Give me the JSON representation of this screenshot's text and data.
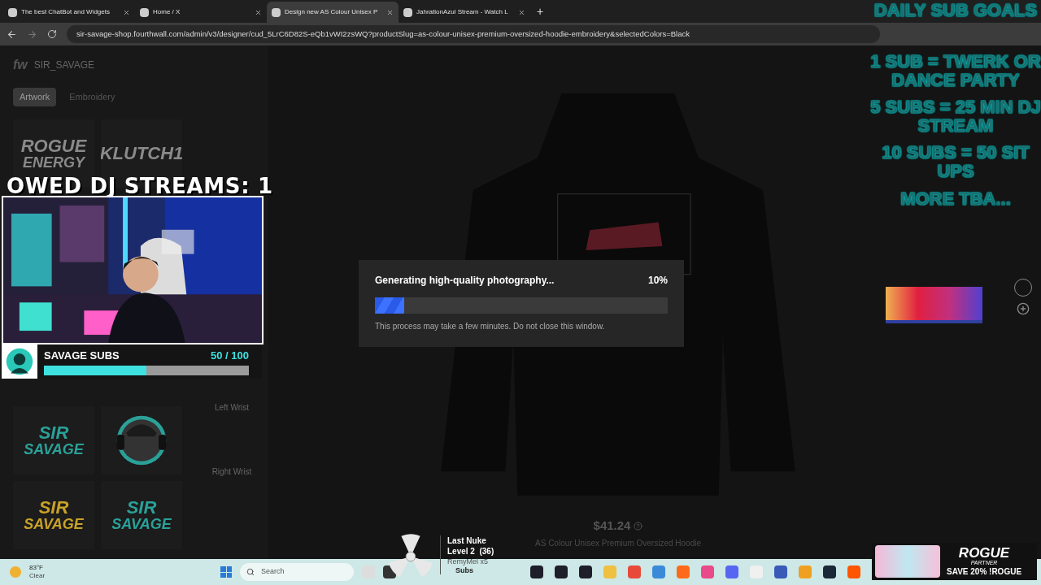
{
  "browser": {
    "tabs": [
      {
        "label": "The best ChatBot and Widgets",
        "selected": false
      },
      {
        "label": "Home / X",
        "selected": false
      },
      {
        "label": "Design new AS Colour Unisex P",
        "selected": true
      },
      {
        "label": "JahrationAzul Stream - Watch L",
        "selected": false
      }
    ],
    "new_tab": "+",
    "url": "sir-savage-shop.fourthwall.com/admin/v3/designer/cud_5LrC6D82S-eQb1vWI2zsWQ?productSlug=as-colour-unisex-premium-oversized-hoodie-embroidery&selectedColors=Black"
  },
  "designer": {
    "brand": "fw",
    "shop": "SIR_SAVAGE",
    "tabs": [
      {
        "label": "Artwork",
        "selected": true
      },
      {
        "label": "Embroidery",
        "selected": false
      }
    ],
    "artwork": [
      {
        "line1": "ROGUE",
        "line2": "ENERGY",
        "color": "#8a8a8a"
      },
      {
        "line1": "KLUTCH1",
        "color": "#8a8a8a"
      },
      {
        "line1": "SIR",
        "line2": "SAVAGE",
        "color": "#2aa198"
      },
      {
        "kind": "avatar",
        "color": "#2aa198"
      },
      {
        "line1": "SIR",
        "line2": "SAVAGE",
        "color": "#c9a227"
      },
      {
        "line1": "SIR",
        "line2": "SAVAGE",
        "color": "#2aa198"
      }
    ],
    "placements": [
      "Left Wrist",
      "Right Wrist"
    ],
    "price": "$41.24",
    "product": "AS Colour Unisex Premium Oversized Hoodie"
  },
  "progress_dialog": {
    "title": "Generating high-quality photography...",
    "percent": "10%",
    "level": 0.1,
    "note": "This process may take a few minutes. Do not close this window."
  },
  "stream_overlay": {
    "owed": "OWED DJ STREAMS: 1",
    "sub_goal": {
      "label": "SAVAGE SUBS",
      "count": "50 / 100",
      "level": 0.5
    },
    "goals_title": "DAILY SUB GOALS",
    "goals": [
      "1 SUB = TWERK OR DANCE PARTY",
      "5 SUBS = 25 MIN DJ STREAM",
      "10 SUBS = 50 SIT UPS",
      "MORE TBA..."
    ],
    "nuke": {
      "title": "Last Nuke",
      "level": "Level 2  (36)",
      "user": "RemyMel x5",
      "subs": "Subs"
    },
    "ad": {
      "brand": "ROGUE",
      "tag": "PARTNER",
      "offer": "SAVE 20% !ROGUE"
    }
  },
  "taskbar": {
    "temperature": "83°F",
    "weather": "Clear",
    "search": "Search"
  }
}
